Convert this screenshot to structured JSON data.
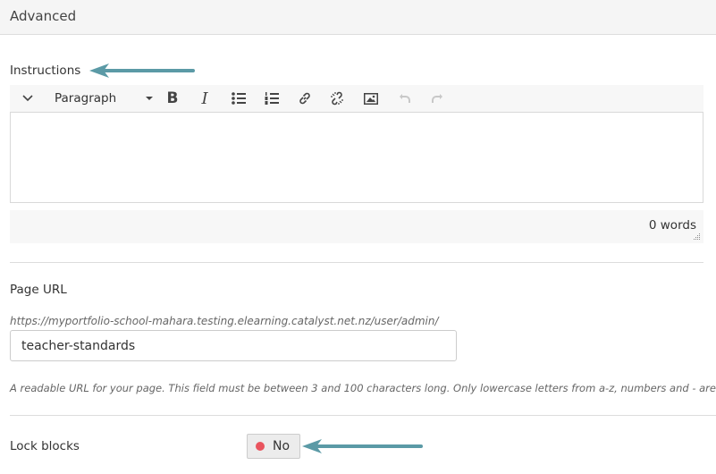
{
  "section": {
    "title": "Advanced"
  },
  "instructions": {
    "label": "Instructions",
    "toolbar": {
      "collapse_icon": "chevron-down-icon",
      "format_select": "Paragraph",
      "buttons": [
        {
          "name": "bold",
          "icon": "bold-icon",
          "enabled": true
        },
        {
          "name": "italic",
          "icon": "italic-icon",
          "enabled": true
        },
        {
          "name": "bullet-list",
          "icon": "bullet-list-icon",
          "enabled": true
        },
        {
          "name": "numbered-list",
          "icon": "numbered-list-icon",
          "enabled": true
        },
        {
          "name": "link",
          "icon": "link-icon",
          "enabled": true
        },
        {
          "name": "unlink",
          "icon": "unlink-icon",
          "enabled": true
        },
        {
          "name": "image",
          "icon": "image-icon",
          "enabled": true
        },
        {
          "name": "undo",
          "icon": "undo-icon",
          "enabled": false
        },
        {
          "name": "redo",
          "icon": "redo-icon",
          "enabled": false
        }
      ]
    },
    "content": "",
    "word_count": "0 words"
  },
  "page_url": {
    "label": "Page URL",
    "prefix": "https://myportfolio-school-mahara.testing.elearning.catalyst.net.nz/user/admin/",
    "value": "teacher-standards",
    "help": "A readable URL for your page. This field must be between 3 and 100 characters long. Only lowercase letters from a-z, numbers and - are allowed."
  },
  "lock_blocks": {
    "label": "Lock blocks",
    "value": "No",
    "state": false,
    "status_color": "#e9545e"
  },
  "annotation": {
    "arrow_color": "#5b9aa6"
  }
}
